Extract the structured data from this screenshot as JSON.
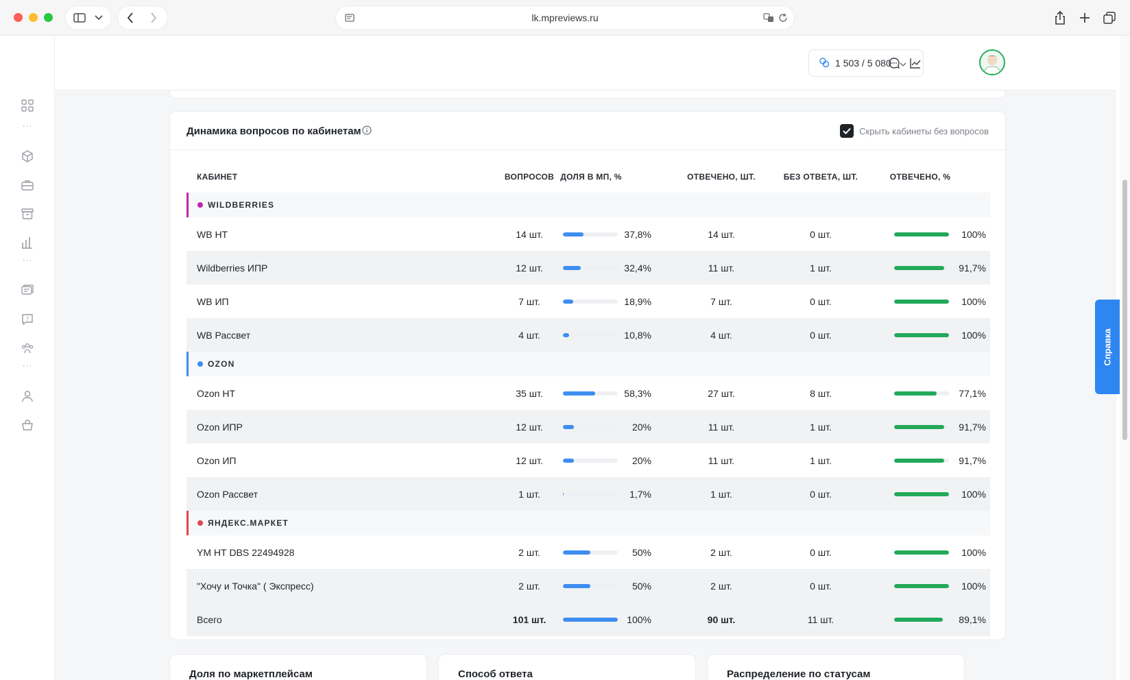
{
  "browser": {
    "url": "lk.mpreviews.ru"
  },
  "topbar": {
    "quota": "1 503 / 5 080"
  },
  "card": {
    "title": "Динамика вопросов по кабинетам",
    "hide_empty_label": "Скрыть кабинеты без вопросов",
    "hide_empty_checked": true,
    "columns": {
      "cabinet": "КАБИНЕТ",
      "questions": "ВОПРОСОВ",
      "share": "ДОЛЯ В МП, %",
      "answered": "ОТВЕЧЕНО, ШТ.",
      "unanswered": "БЕЗ ОТВЕТА, ШТ.",
      "answered_pct": "ОТВЕЧЕНО, %"
    },
    "groups": [
      {
        "name": "WILDBERRIES",
        "color": "#c026a8",
        "rows": [
          {
            "name": "WB НТ",
            "questions": "14 шт.",
            "share": "37,8%",
            "share_value": 37.8,
            "answered": "14 шт.",
            "unanswered": "0 шт.",
            "answered_pct": "100%",
            "answered_pct_value": 100
          },
          {
            "name": "Wildberries ИПР",
            "questions": "12 шт.",
            "share": "32,4%",
            "share_value": 32.4,
            "answered": "11 шт.",
            "unanswered": "1 шт.",
            "answered_pct": "91,7%",
            "answered_pct_value": 91.7
          },
          {
            "name": "WB ИП",
            "questions": "7 шт.",
            "share": "18,9%",
            "share_value": 18.9,
            "answered": "7 шт.",
            "unanswered": "0 шт.",
            "answered_pct": "100%",
            "answered_pct_value": 100
          },
          {
            "name": "WB Рассвет",
            "questions": "4 шт.",
            "share": "10,8%",
            "share_value": 10.8,
            "answered": "4 шт.",
            "unanswered": "0 шт.",
            "answered_pct": "100%",
            "answered_pct_value": 100
          }
        ]
      },
      {
        "name": "OZON",
        "color": "#3d8ef0",
        "rows": [
          {
            "name": "Ozon НТ",
            "questions": "35 шт.",
            "share": "58,3%",
            "share_value": 58.3,
            "answered": "27 шт.",
            "unanswered": "8 шт.",
            "answered_pct": "77,1%",
            "answered_pct_value": 77.1
          },
          {
            "name": "Ozon ИПР",
            "questions": "12 шт.",
            "share": "20%",
            "share_value": 20,
            "answered": "11 шт.",
            "unanswered": "1 шт.",
            "answered_pct": "91,7%",
            "answered_pct_value": 91.7
          },
          {
            "name": "Ozon ИП",
            "questions": "12 шт.",
            "share": "20%",
            "share_value": 20,
            "answered": "11 шт.",
            "unanswered": "1 шт.",
            "answered_pct": "91,7%",
            "answered_pct_value": 91.7
          },
          {
            "name": "Ozon Рассвет",
            "questions": "1 шт.",
            "share": "1,7%",
            "share_value": 1.7,
            "answered": "1 шт.",
            "unanswered": "0 шт.",
            "answered_pct": "100%",
            "answered_pct_value": 100
          }
        ]
      },
      {
        "name": "ЯНДЕКС.МАРКЕТ",
        "color": "#e0484f",
        "rows": [
          {
            "name": "YM НТ DBS 22494928",
            "questions": "2 шт.",
            "share": "50%",
            "share_value": 50,
            "answered": "2 шт.",
            "unanswered": "0 шт.",
            "answered_pct": "100%",
            "answered_pct_value": 100
          },
          {
            "name": "\"Хочу и Точка\" ( Экспресс)",
            "questions": "2 шт.",
            "share": "50%",
            "share_value": 50,
            "answered": "2 шт.",
            "unanswered": "0 шт.",
            "answered_pct": "100%",
            "answered_pct_value": 100
          }
        ]
      }
    ],
    "total": {
      "name": "Всего",
      "questions": "101 шт.",
      "share": "100%",
      "share_value": 100,
      "answered": "90 шт.",
      "unanswered": "11 шт.",
      "answered_pct": "89,1%",
      "answered_pct_value": 89.1
    }
  },
  "bottom_cards": [
    {
      "title": "Доля по маркетплейсам"
    },
    {
      "title": "Способ ответа"
    },
    {
      "title": "Распределение по статусам"
    }
  ],
  "help_tab": "Справка",
  "colors": {
    "share_bar": "#3d8ef0",
    "answered_bar": "#22a95a"
  }
}
